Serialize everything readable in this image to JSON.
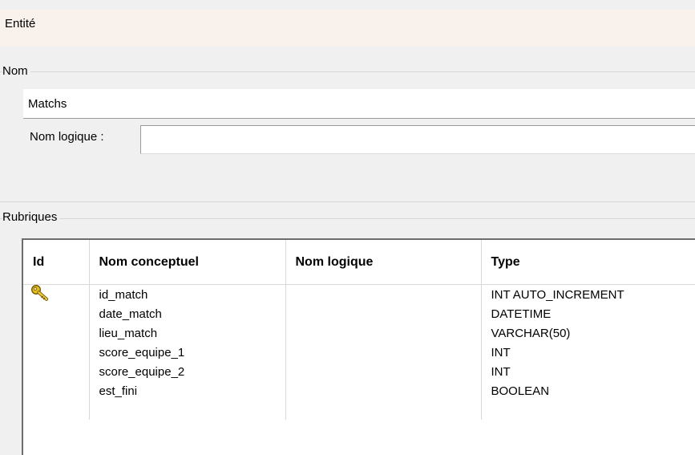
{
  "header": {
    "title": "Entité"
  },
  "nom_group": {
    "label": "Nom",
    "value": "Matchs"
  },
  "logique": {
    "label": "Nom logique :",
    "value": ""
  },
  "rubriques": {
    "label": "Rubriques",
    "columns": [
      "Id",
      "Nom conceptuel",
      "Nom logique",
      "Type"
    ],
    "rows": [
      {
        "id_icon": "key-icon",
        "nom": "id_match",
        "logique": "",
        "type": "INT AUTO_INCREMENT"
      },
      {
        "id_icon": "",
        "nom": "date_match",
        "logique": "",
        "type": "DATETIME"
      },
      {
        "id_icon": "",
        "nom": "lieu_match",
        "logique": "",
        "type": "VARCHAR(50)"
      },
      {
        "id_icon": "",
        "nom": "score_equipe_1",
        "logique": "",
        "type": "INT"
      },
      {
        "id_icon": "",
        "nom": "score_equipe_2",
        "logique": "",
        "type": "INT"
      },
      {
        "id_icon": "",
        "nom": "est_fini",
        "logique": "",
        "type": "BOOLEAN"
      }
    ]
  }
}
